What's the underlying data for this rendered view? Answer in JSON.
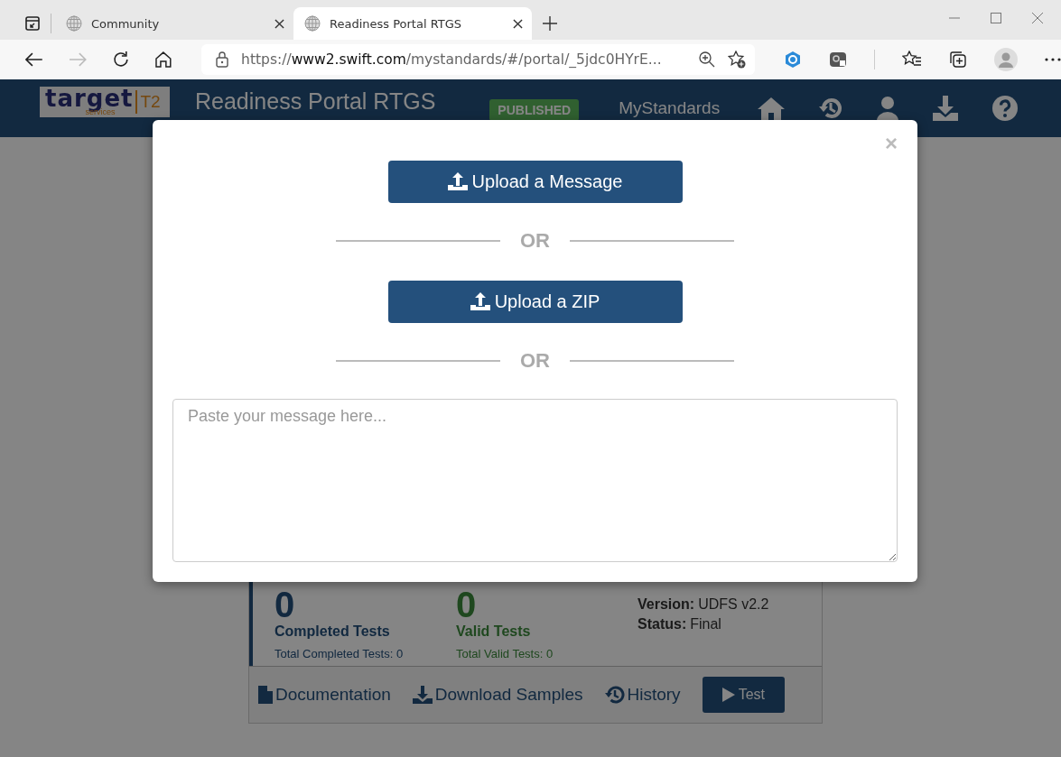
{
  "browser": {
    "tabs": [
      {
        "title": "Community",
        "selected": false
      },
      {
        "title": "Readiness Portal RTGS",
        "selected": true
      }
    ],
    "url": {
      "scheme": "https://",
      "host": "www2.swift.com",
      "path": "/mystandards/#/portal/_5jdc0HYrE..."
    }
  },
  "header": {
    "logo": {
      "word": "target",
      "sub": "services",
      "code": "T2"
    },
    "title": "Readiness Portal RTGS",
    "badge": "PUBLISHED",
    "link": "MyStandards"
  },
  "card": {
    "stats": [
      {
        "kind": "completed",
        "count": "0",
        "label": "Completed Tests",
        "total": "Total Completed Tests: 0"
      },
      {
        "kind": "valid",
        "count": "0",
        "label": "Valid Tests",
        "total": "Total Valid Tests: 0"
      }
    ],
    "details": [
      {
        "label": "Version:",
        "value": "UDFS v2.2"
      },
      {
        "label": "Status:",
        "value": "Final"
      }
    ],
    "actions": [
      {
        "kind": "link",
        "label": "Documentation"
      },
      {
        "kind": "link",
        "label": "Download Samples"
      },
      {
        "kind": "link",
        "label": "History"
      },
      {
        "kind": "button",
        "label": "Test"
      }
    ]
  },
  "modal": {
    "close": "×",
    "buttons": [
      "Upload a Message",
      "Upload a ZIP"
    ],
    "separators": [
      "OR",
      "OR"
    ],
    "message_field": {
      "placeholder": "Paste your message here..."
    }
  }
}
